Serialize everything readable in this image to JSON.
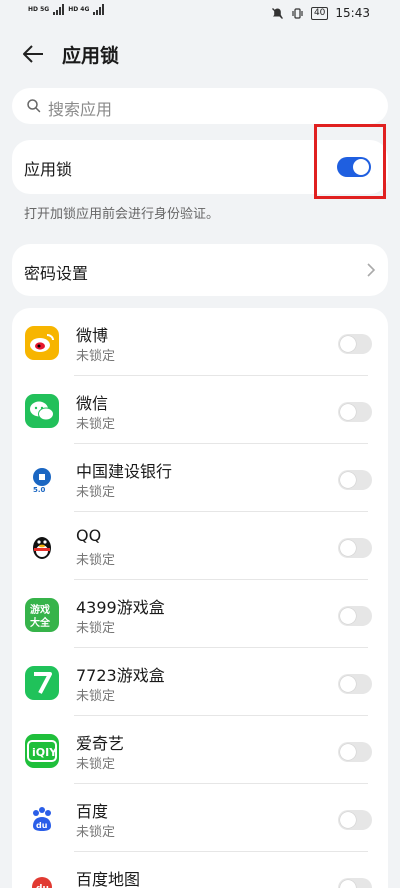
{
  "status_bar": {
    "sim1": "HD 5G",
    "sim2": "HD 4G",
    "battery": "40",
    "time": "15:43"
  },
  "header": {
    "title": "应用锁"
  },
  "search": {
    "placeholder": "搜索应用"
  },
  "app_lock": {
    "label": "应用锁",
    "enabled": true,
    "description": "打开加锁应用前会进行身份验证。"
  },
  "password_settings": {
    "label": "密码设置"
  },
  "apps": [
    {
      "name": "微博",
      "status": "未锁定",
      "icon": "weibo-icon",
      "color": "#f7b500",
      "locked": false
    },
    {
      "name": "微信",
      "status": "未锁定",
      "icon": "wechat-icon",
      "color": "#22c05a",
      "locked": false
    },
    {
      "name": "中国建设银行",
      "status": "未锁定",
      "icon": "ccb-icon",
      "color": "#1a66c2",
      "locked": false
    },
    {
      "name": "QQ",
      "status": "未锁定",
      "icon": "qq-icon",
      "color": "#111111",
      "locked": false
    },
    {
      "name": "4399游戏盒",
      "status": "未锁定",
      "icon": "4399-icon",
      "color": "#36b34a",
      "locked": false
    },
    {
      "name": "7723游戏盒",
      "status": "未锁定",
      "icon": "7723-icon",
      "color": "#20c25a",
      "locked": false
    },
    {
      "name": "爱奇艺",
      "status": "未锁定",
      "icon": "iqiyi-icon",
      "color": "#1fbf3b",
      "locked": false
    },
    {
      "name": "百度",
      "status": "未锁定",
      "icon": "baidu-icon",
      "color": "#2a5ee8",
      "locked": false
    },
    {
      "name": "百度地图",
      "status": "",
      "icon": "baidu-map-icon",
      "color": "#e13a32",
      "locked": false
    }
  ],
  "colors": {
    "accent": "#1f5fe0",
    "highlight": "#e02020"
  }
}
